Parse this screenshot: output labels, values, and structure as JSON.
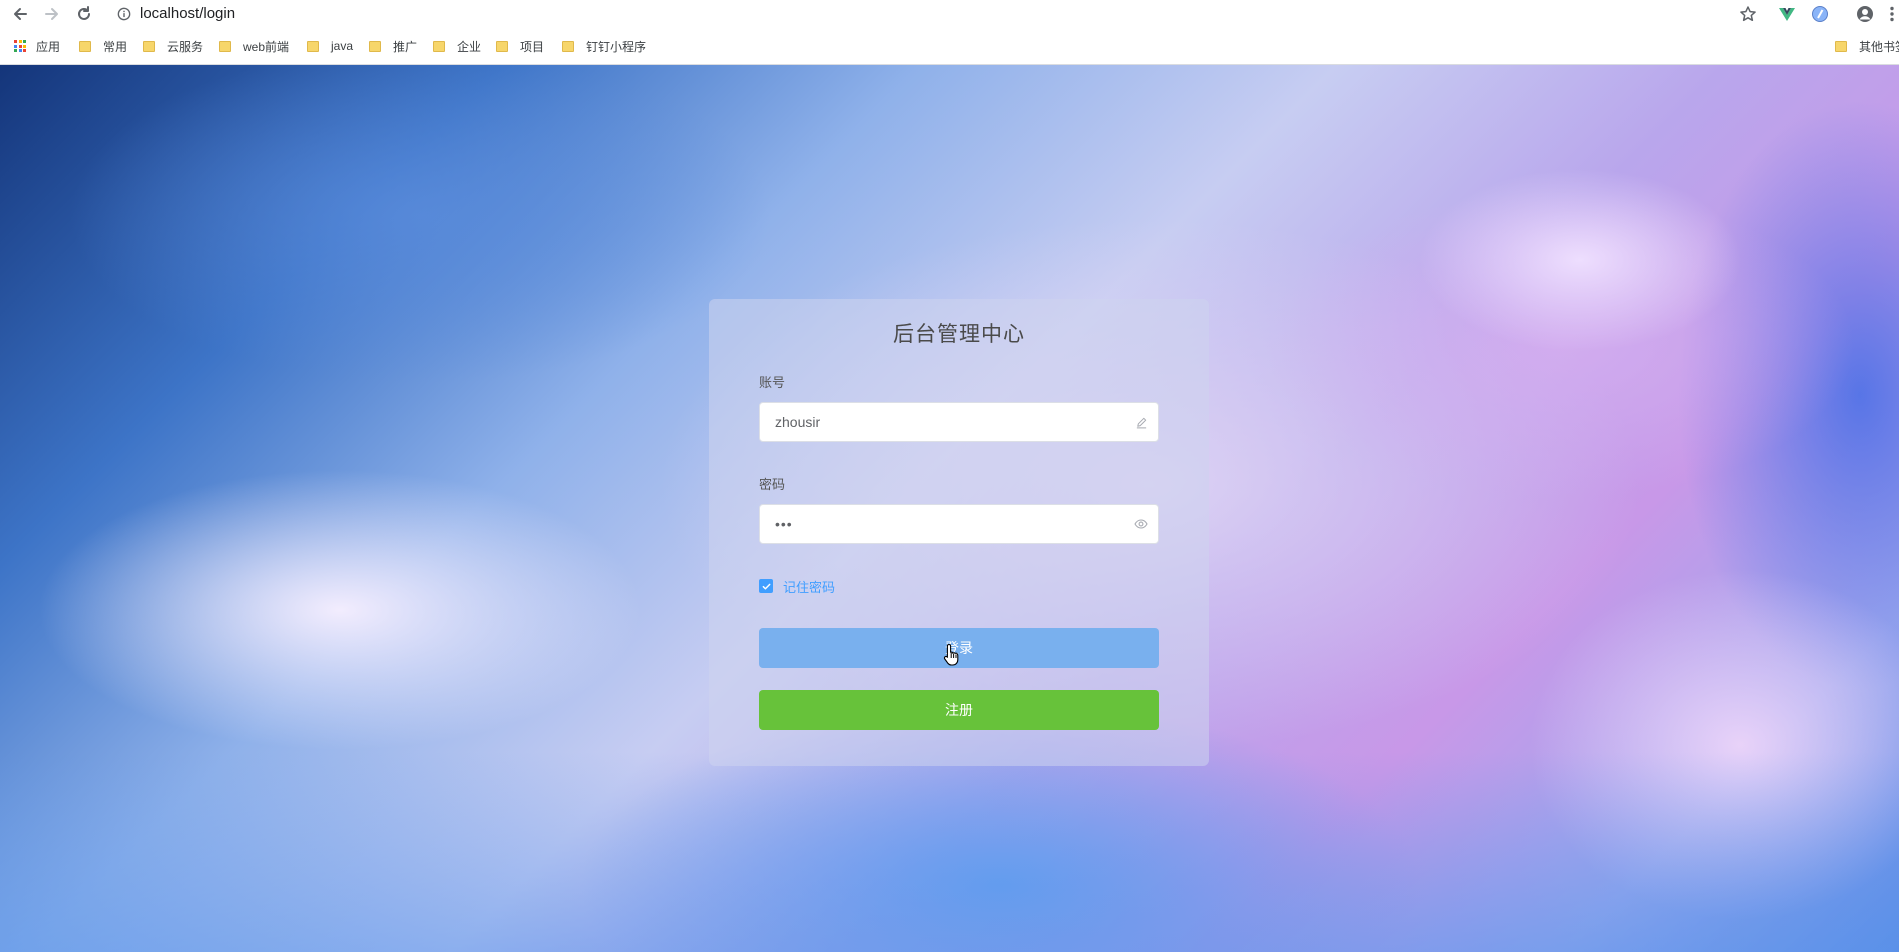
{
  "browser": {
    "url": "localhost/login",
    "bookmarks": [
      {
        "label": "应用",
        "type": "apps"
      },
      {
        "label": "常用",
        "type": "folder"
      },
      {
        "label": "云服务",
        "type": "folder"
      },
      {
        "label": "web前端",
        "type": "folder"
      },
      {
        "label": "java",
        "type": "folder"
      },
      {
        "label": "推广",
        "type": "folder"
      },
      {
        "label": "企业",
        "type": "folder"
      },
      {
        "label": "项目",
        "type": "folder"
      },
      {
        "label": "钉钉小程序",
        "type": "folder"
      }
    ],
    "other_bookmarks": "其他书签",
    "icons": [
      "back-arrow-icon",
      "forward-arrow-icon",
      "reload-icon",
      "info-icon",
      "star-icon",
      "vue-devtools-icon",
      "extension-icon",
      "profile-icon",
      "menu-icon"
    ]
  },
  "login": {
    "title": "后台管理中心",
    "account_label": "账号",
    "account_value": "zhousir",
    "password_label": "密码",
    "password_value": "•••",
    "remember_label": "记住密码",
    "remember_checked": true,
    "login_button": "登录",
    "register_button": "注册"
  },
  "colors": {
    "primary": "#409eff",
    "login_button": "#79b0ee",
    "register_button": "#67c23a"
  }
}
